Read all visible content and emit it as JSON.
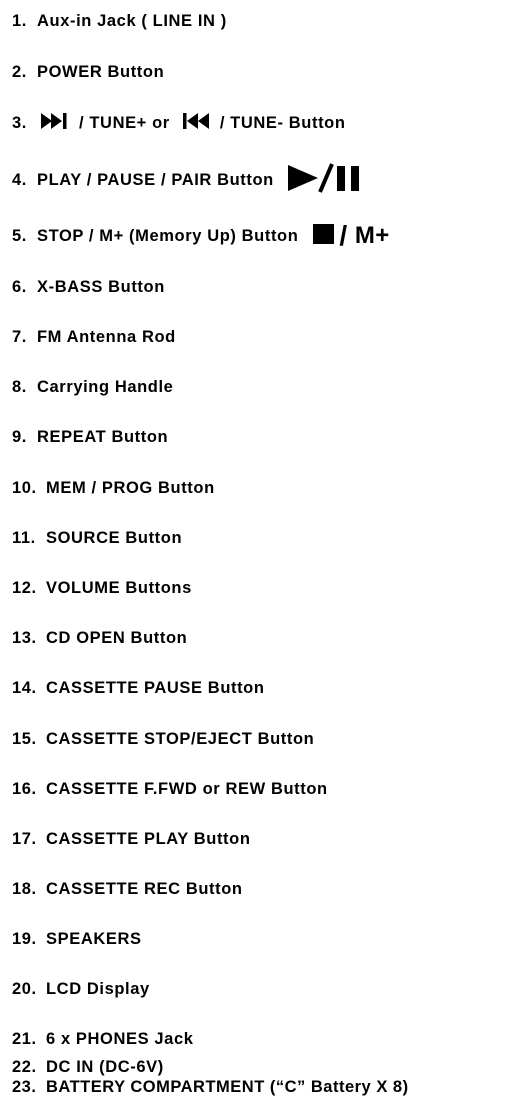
{
  "items": [
    {
      "num": "1.",
      "text": "Aux-in Jack ( LINE IN )"
    },
    {
      "num": "2.",
      "text": "POWER Button"
    },
    {
      "num": "3.",
      "text_a": "/ TUNE+ or",
      "text_b": "/ TUNE- Button",
      "icon_a": "skip-next-icon",
      "icon_b": "skip-previous-icon"
    },
    {
      "num": "4.",
      "text": "PLAY / PAUSE / PAIR Button",
      "icon": "play-pause-icon"
    },
    {
      "num": "5.",
      "text": "STOP / M+ (Memory Up) Button",
      "icon": "stop-icon",
      "symbol": "M+"
    },
    {
      "num": "6.",
      "text": "X-BASS Button"
    },
    {
      "num": "7.",
      "text": "FM Antenna Rod"
    },
    {
      "num": "8.",
      "text": "Carrying Handle"
    },
    {
      "num": "9.",
      "text": "REPEAT Button"
    },
    {
      "num": "10.",
      "text": "MEM / PROG Button"
    },
    {
      "num": "11.",
      "text": "SOURCE Button"
    },
    {
      "num": "12.",
      "text": "VOLUME Buttons"
    },
    {
      "num": "13.",
      "text": "CD OPEN Button"
    },
    {
      "num": "14.",
      "text": "CASSETTE PAUSE Button"
    },
    {
      "num": "15.",
      "text": "CASSETTE STOP/EJECT Button"
    },
    {
      "num": "16.",
      "text": "CASSETTE F.FWD or REW Button"
    },
    {
      "num": "17.",
      "text": "CASSETTE PLAY Button"
    },
    {
      "num": "18.",
      "text": "CASSETTE REC Button"
    },
    {
      "num": "19.",
      "text": "SPEAKERS"
    },
    {
      "num": "20.",
      "text": "LCD Display"
    },
    {
      "num": "21.",
      "text": "6 x PHONES Jack"
    },
    {
      "num": "22.",
      "text": "DC IN (DC-6V)"
    },
    {
      "num": "23.",
      "text": "BATTERY COMPARTMENT (“C” Battery X 8)"
    }
  ]
}
